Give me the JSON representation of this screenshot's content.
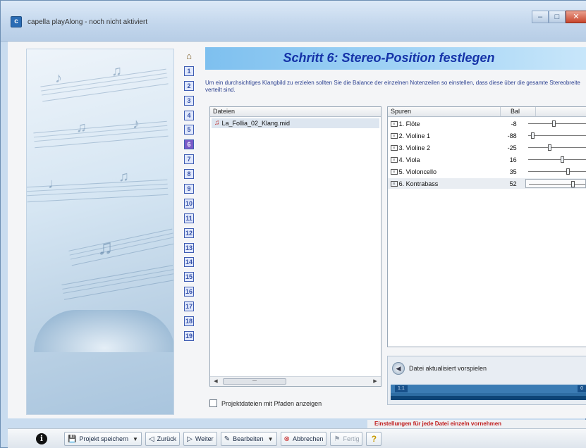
{
  "window": {
    "title": "capella playAlong - noch nicht aktiviert",
    "app_icon": "app-icon",
    "controls": {
      "minimize": "–",
      "maximize": "□",
      "close": "✕"
    }
  },
  "steps": {
    "home_icon": "⌂",
    "items": [
      "1",
      "2",
      "3",
      "4",
      "5",
      "6",
      "7",
      "8",
      "9",
      "10",
      "11",
      "12",
      "13",
      "14",
      "15",
      "16",
      "17",
      "18",
      "19"
    ],
    "current": "6"
  },
  "header": {
    "title": "Schritt 6: Stereo-Position festlegen",
    "intro": "Um ein durchsichtiges Klangbild zu erzielen sollten Sie die Balance der einzelnen Notenzeilen so einstellen, dass diese über die gesamte Stereobreite verteilt sind."
  },
  "files": {
    "column": "Dateien",
    "items": [
      {
        "name": "La_Follia_02_Klang.mid"
      }
    ],
    "scroll_thumb": "—"
  },
  "project_checkbox": {
    "label": "Projektdateien mit Pfaden anzeigen",
    "checked": false
  },
  "tracks": {
    "col_name": "Spuren",
    "col_balance": "Bal",
    "rows": [
      {
        "name": "1. Flöte",
        "balance": -8,
        "knob_fraction": 0.43,
        "selected": false
      },
      {
        "name": "2. Violine 1",
        "balance": -88,
        "knob_fraction": 0.05,
        "selected": false
      },
      {
        "name": "3. Violine 2",
        "balance": -25,
        "knob_fraction": 0.35,
        "selected": false
      },
      {
        "name": "4. Viola",
        "balance": 16,
        "knob_fraction": 0.58,
        "selected": false
      },
      {
        "name": "5. Violoncello",
        "balance": 35,
        "knob_fraction": 0.68,
        "selected": false
      },
      {
        "name": "6. Kontrabass",
        "balance": 52,
        "knob_fraction": 0.76,
        "selected": true
      }
    ]
  },
  "preview": {
    "label": "Datei aktualisiert vorspielen",
    "time_start": "1:1",
    "time_end": "0"
  },
  "status": {
    "message": "Einstellungen für jede Datei einzeln vornehmen"
  },
  "toolbar": {
    "info_label": "i",
    "save_label": "Projekt speichern",
    "back_label": "Zurück",
    "next_label": "Weiter",
    "edit_label": "Bearbeiten",
    "cancel_label": "Abbrechen",
    "finish_label": "Fertig",
    "help_label": "?"
  },
  "colors": {
    "header_title": "#1533a8",
    "header_bar": "#9fd2f5",
    "status_text": "#c01a1a",
    "step_border": "#3f5db3",
    "progress": "#2e6da3"
  }
}
